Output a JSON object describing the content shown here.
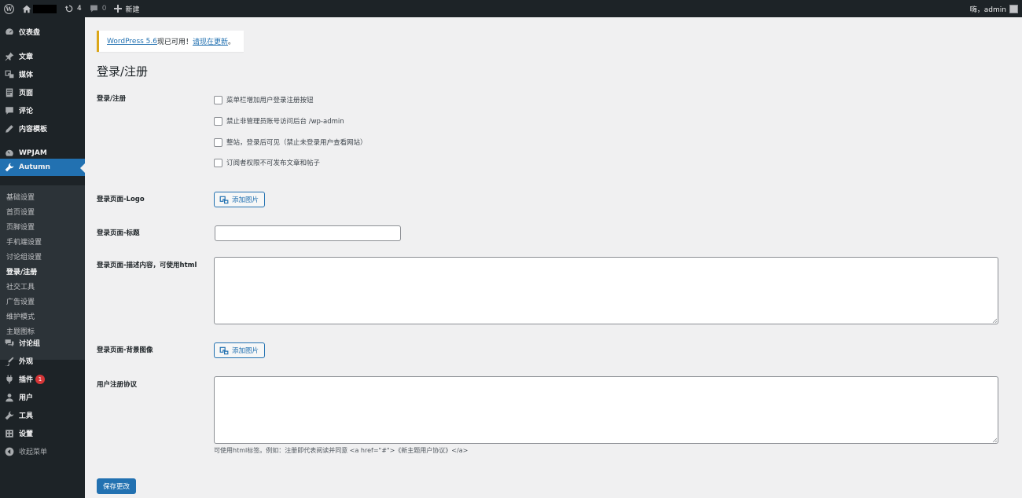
{
  "admin_bar": {
    "update_count": "4",
    "comment_count": "0",
    "new_label": "新建",
    "greeting": "嗨，admin"
  },
  "sidebar": {
    "items": [
      {
        "label": "仪表盘",
        "icon": "dashboard-icon"
      },
      {
        "label": "文章",
        "icon": "pushpin-icon"
      },
      {
        "label": "媒体",
        "icon": "media-icon"
      },
      {
        "label": "页面",
        "icon": "page-icon"
      },
      {
        "label": "评论",
        "icon": "comment-icon"
      },
      {
        "label": "内容模板",
        "icon": "edit-icon"
      },
      {
        "label": "WPJAM",
        "icon": "gauge-icon"
      },
      {
        "label": "Autumn",
        "icon": "wrench-icon"
      },
      {
        "label": "讨论组",
        "icon": "forum-icon"
      },
      {
        "label": "外观",
        "icon": "paintbrush-icon"
      },
      {
        "label": "插件",
        "icon": "plugin-icon",
        "badge": "1"
      },
      {
        "label": "用户",
        "icon": "user-icon"
      },
      {
        "label": "工具",
        "icon": "tools-icon"
      },
      {
        "label": "设置",
        "icon": "settings-icon"
      },
      {
        "label": "收起菜单",
        "icon": "collapse-icon"
      }
    ],
    "submenu": [
      "基础设置",
      "首页设置",
      "页脚设置",
      "手机端设置",
      "讨论组设置",
      "登录/注册",
      "社交工具",
      "广告设置",
      "维护模式",
      "主题图标"
    ]
  },
  "notice": {
    "link_text": "WordPress 5.6",
    "middle_text": "现已可用！",
    "update_link": "请现在更新",
    "end": "。"
  },
  "page": {
    "title": "登录/注册",
    "section_label": "登录/注册",
    "checkboxes": [
      "菜单栏增加用户登录注册按钮",
      "禁止非管理员账号访问后台 /wp-admin",
      "整站，登录后可见（禁止未登录用户查看网站）",
      "订阅者权限不可发布文章和帖子"
    ],
    "logo_label": "登录页面-Logo",
    "add_image_label": "添加图片",
    "title_label": "登录页面-标题",
    "title_value": "",
    "desc_label": "登录页面-描述内容，可使用html",
    "bg_label": "登录页面-背景图像",
    "agreement_label": "用户注册协议",
    "agreement_hint": "可使用html标签。例如：注册即代表阅读并同意 <a href=\"#\">《新主题用户协议》</a>",
    "save_label": "保存更改"
  },
  "colors": {
    "accent": "#2271b1",
    "sidebar_bg": "#1d2327",
    "notice_border": "#dba617",
    "badge": "#d63638"
  }
}
